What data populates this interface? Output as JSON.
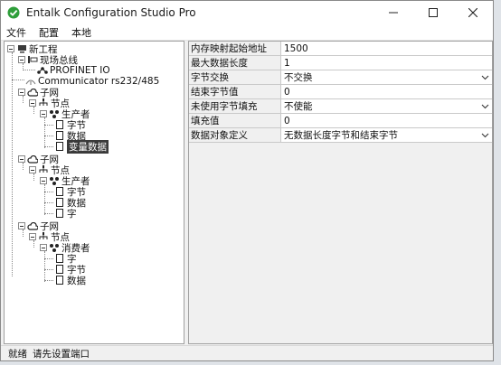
{
  "window": {
    "title": "Entalk Configuration Studio Pro"
  },
  "menu": [
    "文件",
    "配置",
    "本地"
  ],
  "tree": {
    "root": "新工程",
    "fieldbus": "现场总线",
    "profinet": "PROFINET IO",
    "communicator": "Communicator rs232/485",
    "subnets": [
      {
        "label": "子网",
        "node": "节点",
        "role": "生产者",
        "items": [
          "字节",
          "数据",
          "变量数据"
        ]
      },
      {
        "label": "子网",
        "node": "节点",
        "role": "生产者",
        "items": [
          "字节",
          "数据",
          "字"
        ]
      },
      {
        "label": "子网",
        "node": "节点",
        "role": "消费者",
        "items": [
          "字",
          "字节",
          "数据"
        ]
      }
    ]
  },
  "properties": [
    {
      "name": "内存映射起始地址",
      "value": "1500",
      "dropdown": false
    },
    {
      "name": "最大数据长度",
      "value": "1",
      "dropdown": false
    },
    {
      "name": "字节交换",
      "value": "不交换",
      "dropdown": true
    },
    {
      "name": "结束字节值",
      "value": "0",
      "dropdown": false
    },
    {
      "name": "未使用字节填充",
      "value": "不使能",
      "dropdown": true
    },
    {
      "name": "填充值",
      "value": "0",
      "dropdown": false
    },
    {
      "name": "数据对象定义",
      "value": "无数据长度字节和结束字节",
      "dropdown": true
    }
  ],
  "status": {
    "left": "就绪",
    "right": "请先设置端口"
  }
}
